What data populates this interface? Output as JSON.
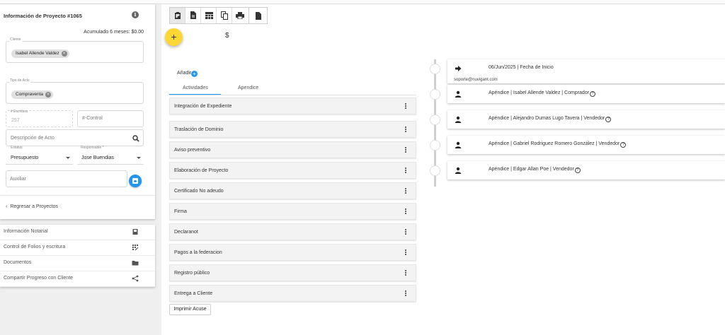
{
  "project": {
    "title": "Información de Proyecto #1065",
    "accumulated": "Acumulado 6 meses: $0.00",
    "client_label": "Cliente",
    "client_chip": "Isabel Allende Valdez",
    "act_type_label": "Tipo de Acto",
    "act_type_chip": "Compraventa",
    "escritura_label": "# Escritura",
    "escritura_value": "257",
    "control_placeholder": "#-Control",
    "descripcion_placeholder": "Descripción de Acto",
    "status_label": "Estatus",
    "status_value": "Presupuesto",
    "responsable_label": "Responsable *",
    "responsable_value": "Jose Buendias",
    "auxiliar_placeholder": "Auxiliar",
    "back_label": "Regresar a Proyectos"
  },
  "side_menu": [
    {
      "label": "Información Notarial",
      "icon": "book-icon"
    },
    {
      "label": "Control de Folios y escritura",
      "icon": "grid-icon"
    },
    {
      "label": "Documentos",
      "icon": "folder-icon"
    },
    {
      "label": "Compartir Progreso con Cliente",
      "icon": "share-icon"
    }
  ],
  "toolbar_icons": [
    "clipboard-icon",
    "file-icon",
    "table-icon",
    "copy-icon",
    "print-icon",
    "document-icon"
  ],
  "fab_label": "+",
  "dollar": "$",
  "add_label": "Añadir",
  "tabs": [
    {
      "label": "Actividades"
    },
    {
      "label": "Apendice"
    }
  ],
  "activities": [
    "Integración de Expediente",
    "Traslación de Dominio",
    "Aviso preventivo",
    "Elaboración de Proyecto",
    "Certificado No adeudo",
    "Firma",
    "Declaranot",
    "Pagos a la federacion",
    "Registro público",
    "Entrega a Cliente"
  ],
  "print_button": "Imprimir Acuse",
  "timeline": [
    {
      "text": "06/Jun/2025 | Fecha de Inicio",
      "icon": "arrow-right-icon",
      "help": false,
      "email": "soporte@nuvigant.com"
    },
    {
      "text": "Apéndice | Isabel Allende Valdez | Comprador",
      "icon": "person-icon",
      "help": true
    },
    {
      "text": "Apéndice | Alejandro Dumas Lugo Tavera | Vendedor",
      "icon": "person-icon",
      "help": true
    },
    {
      "text": "Apéndice | Gabriel Rodriguez Romero González | Vendedor",
      "icon": "person-icon",
      "help": true
    },
    {
      "text": "Apéndice | Edgar Allan Poe | Vendedor",
      "icon": "person-icon",
      "help": true
    }
  ],
  "help_glyph": "?",
  "colors": {
    "accent": "#2196f3",
    "fab": "#fdd835"
  }
}
